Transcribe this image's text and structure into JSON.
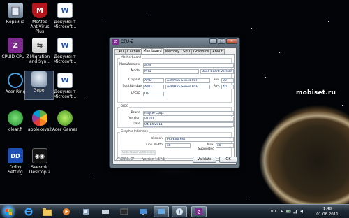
{
  "desktop": {
    "icons": [
      {
        "label": "Корзина",
        "icon": "recycle-bin-icon"
      },
      {
        "label": "McAfee\nAntiVirus Plus",
        "icon": "mcafee-icon"
      },
      {
        "label": "Документ\nMicrosoft...",
        "icon": "word-document-icon"
      },
      {
        "label": "CPUID CPU-Z",
        "icon": "cpuz-icon"
      },
      {
        "label": "Migration\nand Syn...",
        "icon": "migration-icon"
      },
      {
        "label": "Документ\nMicrosoft...",
        "icon": "word-document-icon"
      },
      {
        "label": "Acer Ring",
        "icon": "acer-ring-icon"
      },
      {
        "label": "Зеро",
        "icon": "zero-icon"
      },
      {
        "label": "Документ\nMicrosoft...",
        "icon": "word-document-icon"
      },
      {
        "label": "clear.fi",
        "icon": "clearfi-icon"
      },
      {
        "label": "applekeys2",
        "icon": "apple-icon"
      },
      {
        "label": "Acer Games",
        "icon": "acer-games-icon"
      },
      {
        "label": "Dolby\nSetting",
        "icon": "dolby-icon"
      },
      {
        "label": "Seesmic\nDesktop 2",
        "icon": "seesmic-icon"
      }
    ],
    "watermark": "mobiset.ru"
  },
  "window": {
    "title": "CPU-Z",
    "tabs": [
      "CPU",
      "Caches",
      "Mainboard",
      "Memory",
      "SPD",
      "Graphics",
      "About"
    ],
    "active_tab": "Mainboard",
    "mainboard": {
      "group_title": "Motherboard",
      "manufacturer_label": "Manufacturer",
      "manufacturer_value": "acer",
      "model_label": "Model",
      "model_value": "MT1",
      "model_extra": "Base Board Version",
      "chipset_label": "Chipset",
      "chipset_vendor": "AMD",
      "chipset_model": "A40/A55 Series FCH",
      "chipset_rev_label": "Rev.",
      "chipset_rev": "00",
      "southbridge_label": "Southbridge",
      "southbridge_vendor": "AMD",
      "southbridge_model": "A40/A55 Series FCH",
      "southbridge_rev_label": "Rev.",
      "southbridge_rev": "40",
      "lpcio_label": "LPCIO",
      "lpcio_value": "ITE"
    },
    "bios": {
      "group_title": "BIOS",
      "brand_label": "Brand",
      "brand_value": "Insyde Corp.",
      "version_label": "Version",
      "version_value": "V1.00",
      "date_label": "Date",
      "date_value": "04/14/2011"
    },
    "graphic": {
      "group_title": "Graphic Interface",
      "version_label": "Version",
      "version_value": "PCI-Express",
      "link_width_label": "Link Width",
      "link_width_value": "x0",
      "max_supported_label": "Max. Supported",
      "max_supported_value": "x0",
      "side_band_label": "Side Band Addressing"
    },
    "footer": {
      "brand": "CPU-Z",
      "version": "Version 1.57.1",
      "validate_label": "Validate",
      "ok_label": "OK"
    }
  },
  "taskbar": {
    "lang": "RU",
    "time": "1:48",
    "date": "01.06.2011"
  },
  "colors": {
    "desktop_bg": "#020407",
    "window_frame": "#6a7884",
    "field_text": "#0c2a6a",
    "cpuz_purple": "#7e2a8e"
  }
}
